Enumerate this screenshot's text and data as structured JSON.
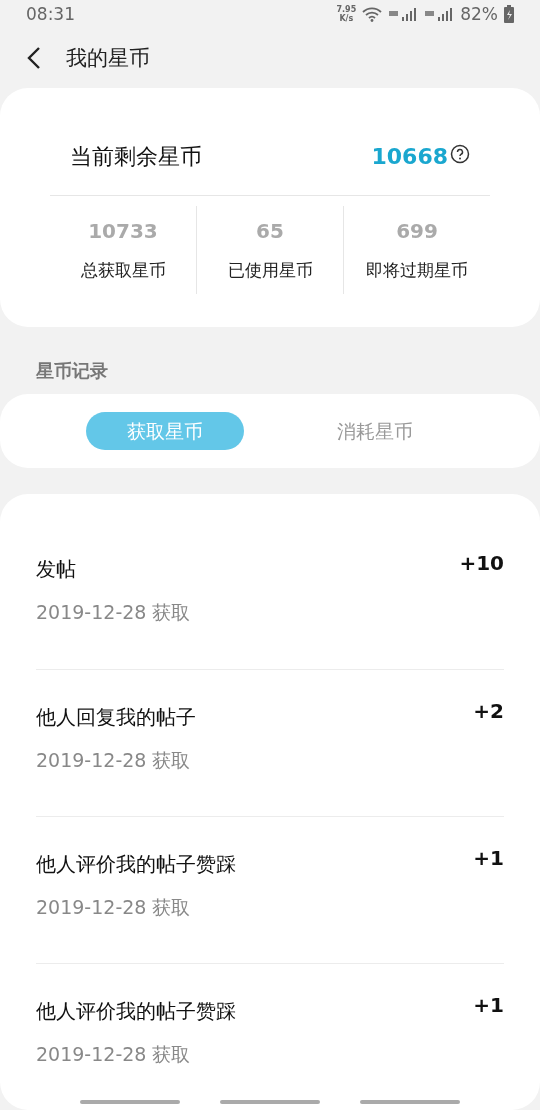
{
  "status_bar": {
    "time": "08:31",
    "net_speed": "7.95",
    "net_unit": "K/s",
    "battery": "82%"
  },
  "header": {
    "title": "我的星币"
  },
  "balance": {
    "label": "当前剩余星币",
    "value": "10668",
    "stats": [
      {
        "value": "10733",
        "label": "总获取星币"
      },
      {
        "value": "65",
        "label": "已使用星币"
      },
      {
        "value": "699",
        "label": "即将过期星币"
      }
    ]
  },
  "section_title": "星币记录",
  "tabs": [
    {
      "label": "获取星币",
      "selected": true
    },
    {
      "label": "消耗星币",
      "selected": false
    }
  ],
  "records": [
    {
      "title": "发帖",
      "date": "2019-12-28 获取",
      "points": "+10"
    },
    {
      "title": "他人回复我的帖子",
      "date": "2019-12-28 获取",
      "points": "+2"
    },
    {
      "title": "他人评价我的帖子赞踩",
      "date": "2019-12-28 获取",
      "points": "+1"
    },
    {
      "title": "他人评价我的帖子赞踩",
      "date": "2019-12-28 获取",
      "points": "+1"
    }
  ]
}
